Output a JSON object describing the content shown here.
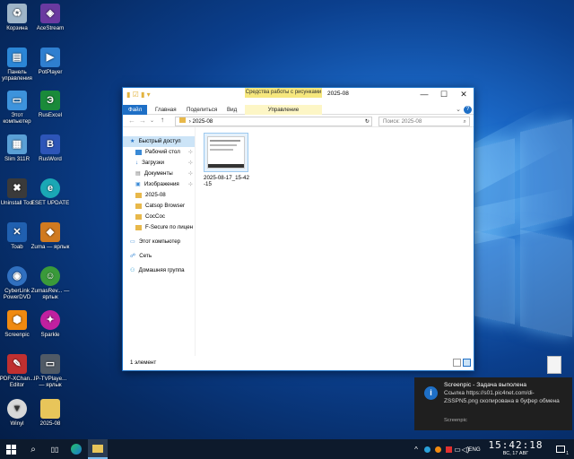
{
  "desktop": {
    "icons": [
      {
        "label": "Корзина",
        "icon": "recycle-bin-icon",
        "color": "#9fb5c8"
      },
      {
        "label": "AceStream",
        "icon": "acestream-icon",
        "color": "#6a3aa0"
      },
      {
        "label": "Панель управления",
        "icon": "control-panel-icon",
        "color": "#2b86d6"
      },
      {
        "label": "PotPlayer",
        "icon": "potplayer-icon",
        "color": "#2f7fd0"
      },
      {
        "label": "Этот компьютер",
        "icon": "computer-icon",
        "color": "#3d93dc"
      },
      {
        "label": "RusExcel",
        "icon": "rusexcel-icon",
        "color": "#1a8a3a"
      },
      {
        "label": "Slim 311R",
        "icon": "slim-icon",
        "color": "#5aa0d6"
      },
      {
        "label": "RusWord",
        "icon": "rusword-icon",
        "color": "#2d55b8"
      },
      {
        "label": "Uninstall Tool",
        "icon": "uninstall-tool-icon",
        "color": "#3a3a3a"
      },
      {
        "label": "ESET UPDATE",
        "icon": "eset-icon",
        "color": "#1aa7b5"
      },
      {
        "label": "Toab",
        "icon": "toab-icon",
        "color": "#2060b0"
      },
      {
        "label": "Zuma — ярлык",
        "icon": "zuma-icon",
        "color": "#d07a20"
      },
      {
        "label": "CyberLink PowerDVD",
        "icon": "powerdvd-icon",
        "color": "#3070c0"
      },
      {
        "label": "ZumasRev... — ярлык",
        "icon": "zumas-revenge-icon",
        "color": "#3a9a3a"
      },
      {
        "label": "Screenpic",
        "icon": "screenpic-icon",
        "color": "#f08a10"
      },
      {
        "label": "Sparkle",
        "icon": "sparkle-icon",
        "color": "#c020a0"
      },
      {
        "label": "PDF-XChan... Editor",
        "icon": "pdf-xchange-icon",
        "color": "#c03030"
      },
      {
        "label": "IP-TVPlaye... — ярлык",
        "icon": "iptv-player-icon",
        "color": "#505a66"
      },
      {
        "label": "Winyl",
        "icon": "winyl-icon",
        "color": "#d8d8d8"
      },
      {
        "label": "2025-08",
        "icon": "folder-icon",
        "color": "#e8c55a"
      }
    ]
  },
  "explorer": {
    "title": "2025-08",
    "contextual_tab": "Средства работы с рисунками",
    "tabs": [
      "Файл",
      "Главная",
      "Поделиться",
      "Вид",
      "Управление"
    ],
    "address": "2025-08",
    "search_placeholder": "Поиск: 2025-08",
    "nav": [
      {
        "label": "Быстрый доступ",
        "icon": "star-icon",
        "pinned": false
      },
      {
        "label": "Рабочий стол",
        "icon": "desktop-folder-icon",
        "pinned": true
      },
      {
        "label": "Загрузки",
        "icon": "downloads-icon",
        "pinned": true
      },
      {
        "label": "Документы",
        "icon": "documents-icon",
        "pinned": true
      },
      {
        "label": "Изображения",
        "icon": "pictures-icon",
        "pinned": true
      },
      {
        "label": "2025-08",
        "icon": "folder-icon",
        "pinned": false
      },
      {
        "label": "Catsop Browser",
        "icon": "folder-icon",
        "pinned": false
      },
      {
        "label": "CocCoc",
        "icon": "folder-icon",
        "pinned": false
      },
      {
        "label": "F-Secure по лицен",
        "icon": "folder-icon",
        "pinned": false
      },
      {
        "label": "Этот компьютер",
        "icon": "computer-icon",
        "pinned": false
      },
      {
        "label": "Сеть",
        "icon": "network-icon",
        "pinned": false
      },
      {
        "label": "Домашняя группа",
        "icon": "homegroup-icon",
        "pinned": false
      }
    ],
    "file": {
      "name": "2025-08-17_15-42-15"
    },
    "status": "1 элемент"
  },
  "notification": {
    "title": "Screenpic - Задача выполена",
    "body": "Ссылка https://s01.pic4net.com/di-ZSSPN5.png скопирована в буфер обмена",
    "app": "Screenpic"
  },
  "taskbar": {
    "lang": "ENG",
    "time": "15:42:18",
    "date": "ВС, 17 АВГ",
    "notifications_count": "1"
  }
}
